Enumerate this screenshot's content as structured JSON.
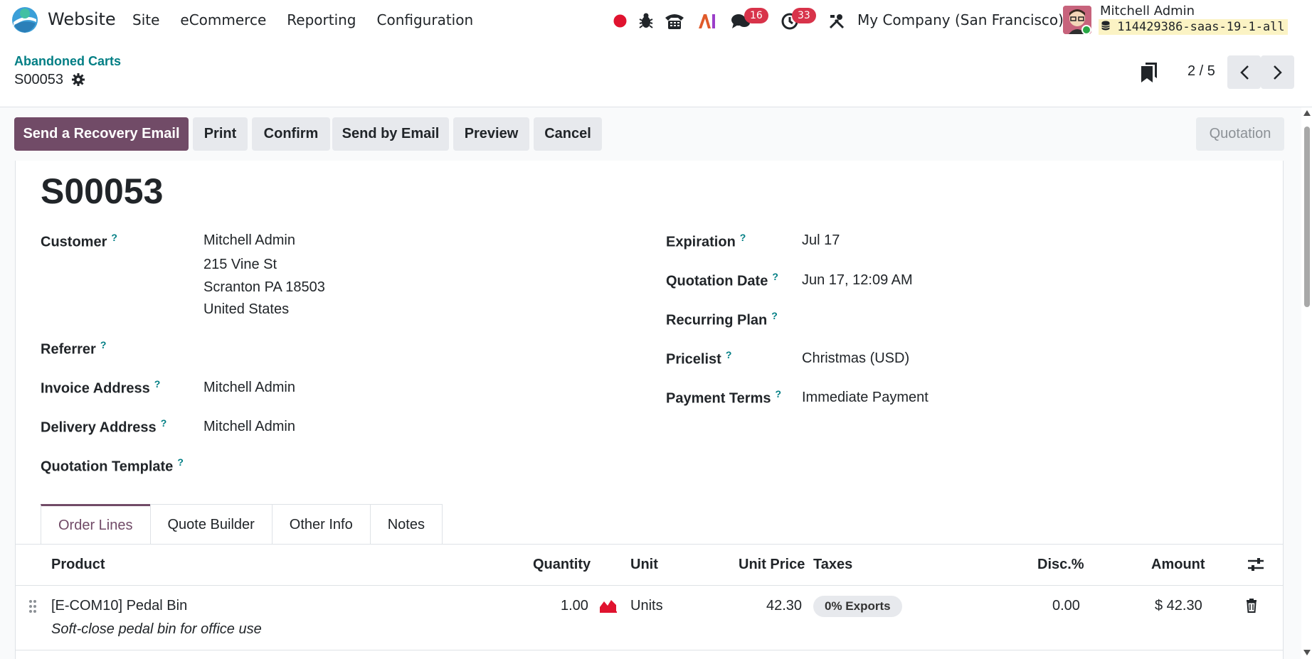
{
  "navbar": {
    "app_name": "Website",
    "menu": [
      "Site",
      "eCommerce",
      "Reporting",
      "Configuration"
    ],
    "messages_count": "16",
    "activities_count": "33",
    "company": "My Company (San Francisco)",
    "user_name": "Mitchell Admin",
    "db_name": "114429386-saas-19-1-all"
  },
  "control_panel": {
    "breadcrumb": "Abandoned Carts",
    "record": "S00053",
    "pager": "2 / 5"
  },
  "buttons": {
    "recovery": "Send a Recovery Email",
    "print": "Print",
    "confirm": "Confirm",
    "send_email": "Send by Email",
    "preview": "Preview",
    "cancel": "Cancel",
    "status": "Quotation"
  },
  "form": {
    "title": "S00053",
    "customer_label": "Customer",
    "customer": "Mitchell Admin",
    "address1": "215 Vine St",
    "address2": "Scranton PA 18503",
    "address3": "United States",
    "referrer_label": "Referrer",
    "invoice_label": "Invoice Address",
    "invoice": "Mitchell Admin",
    "delivery_label": "Delivery Address",
    "delivery": "Mitchell Admin",
    "template_label": "Quotation Template",
    "expiration_label": "Expiration",
    "expiration": "Jul 17",
    "quotation_date_label": "Quotation Date",
    "quotation_date": "Jun 17, 12:09 AM",
    "recurring_label": "Recurring Plan",
    "pricelist_label": "Pricelist",
    "pricelist": "Christmas (USD)",
    "payment_label": "Payment Terms",
    "payment": "Immediate Payment",
    "help": "?"
  },
  "tabs": [
    "Order Lines",
    "Quote Builder",
    "Other Info",
    "Notes"
  ],
  "table": {
    "headers": {
      "product": "Product",
      "quantity": "Quantity",
      "unit": "Unit",
      "unit_price": "Unit Price",
      "taxes": "Taxes",
      "disc": "Disc.%",
      "amount": "Amount"
    },
    "rows": [
      {
        "product": "[E-COM10] Pedal Bin",
        "description": "Soft-close pedal bin for office use",
        "quantity": "1.00",
        "unit": "Units",
        "unit_price": "42.30",
        "tax": "0% Exports",
        "disc": "0.00",
        "amount": "$ 42.30"
      }
    ]
  },
  "colors": {
    "primary": "#714b67",
    "link": "#017e84",
    "badge": "#d8334a",
    "record_dot": "#e0132f"
  }
}
